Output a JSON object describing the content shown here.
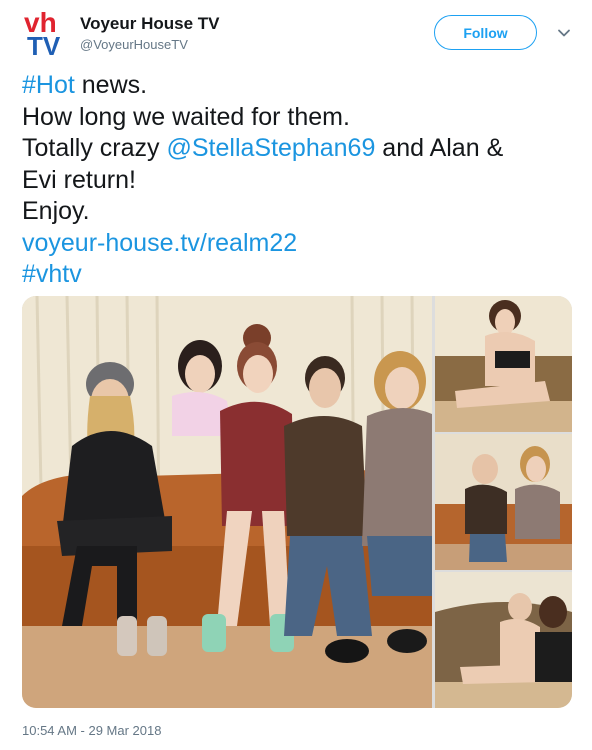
{
  "account": {
    "display_name": "Voyeur House TV",
    "handle": "@VoyeurHouseTV",
    "logo_text_top": "vh",
    "logo_text_bottom": "TV"
  },
  "follow_button": {
    "label": "Follow"
  },
  "tweet": {
    "line1_hashtag": "#Hot",
    "line1_rest": " news.",
    "line2": "How long we waited for them.",
    "line3_pre": "Totally crazy ",
    "line3_mention": "@StellaStephan69",
    "line3_post": " and Alan &",
    "line4": "Evi return!",
    "line5": "Enjoy.",
    "link": "voyeur-house.tv/realm22",
    "hashtag": "#vhtv"
  },
  "media": {
    "main_photo": "group-on-sofa-photo",
    "thumbnails": [
      "couple-on-sofa-photo",
      "pair-on-sofa-photo",
      "couple-on-carved-sofa-photo"
    ]
  },
  "timestamp": "10:54 AM - 29 Mar 2018",
  "colors": {
    "link": "#1b95e0",
    "follow_accent": "#1da1f2",
    "logo_red": "#e0242f",
    "logo_blue": "#1f5fb4",
    "muted": "#657786"
  },
  "icons": {
    "caret": "chevron-down-icon"
  }
}
